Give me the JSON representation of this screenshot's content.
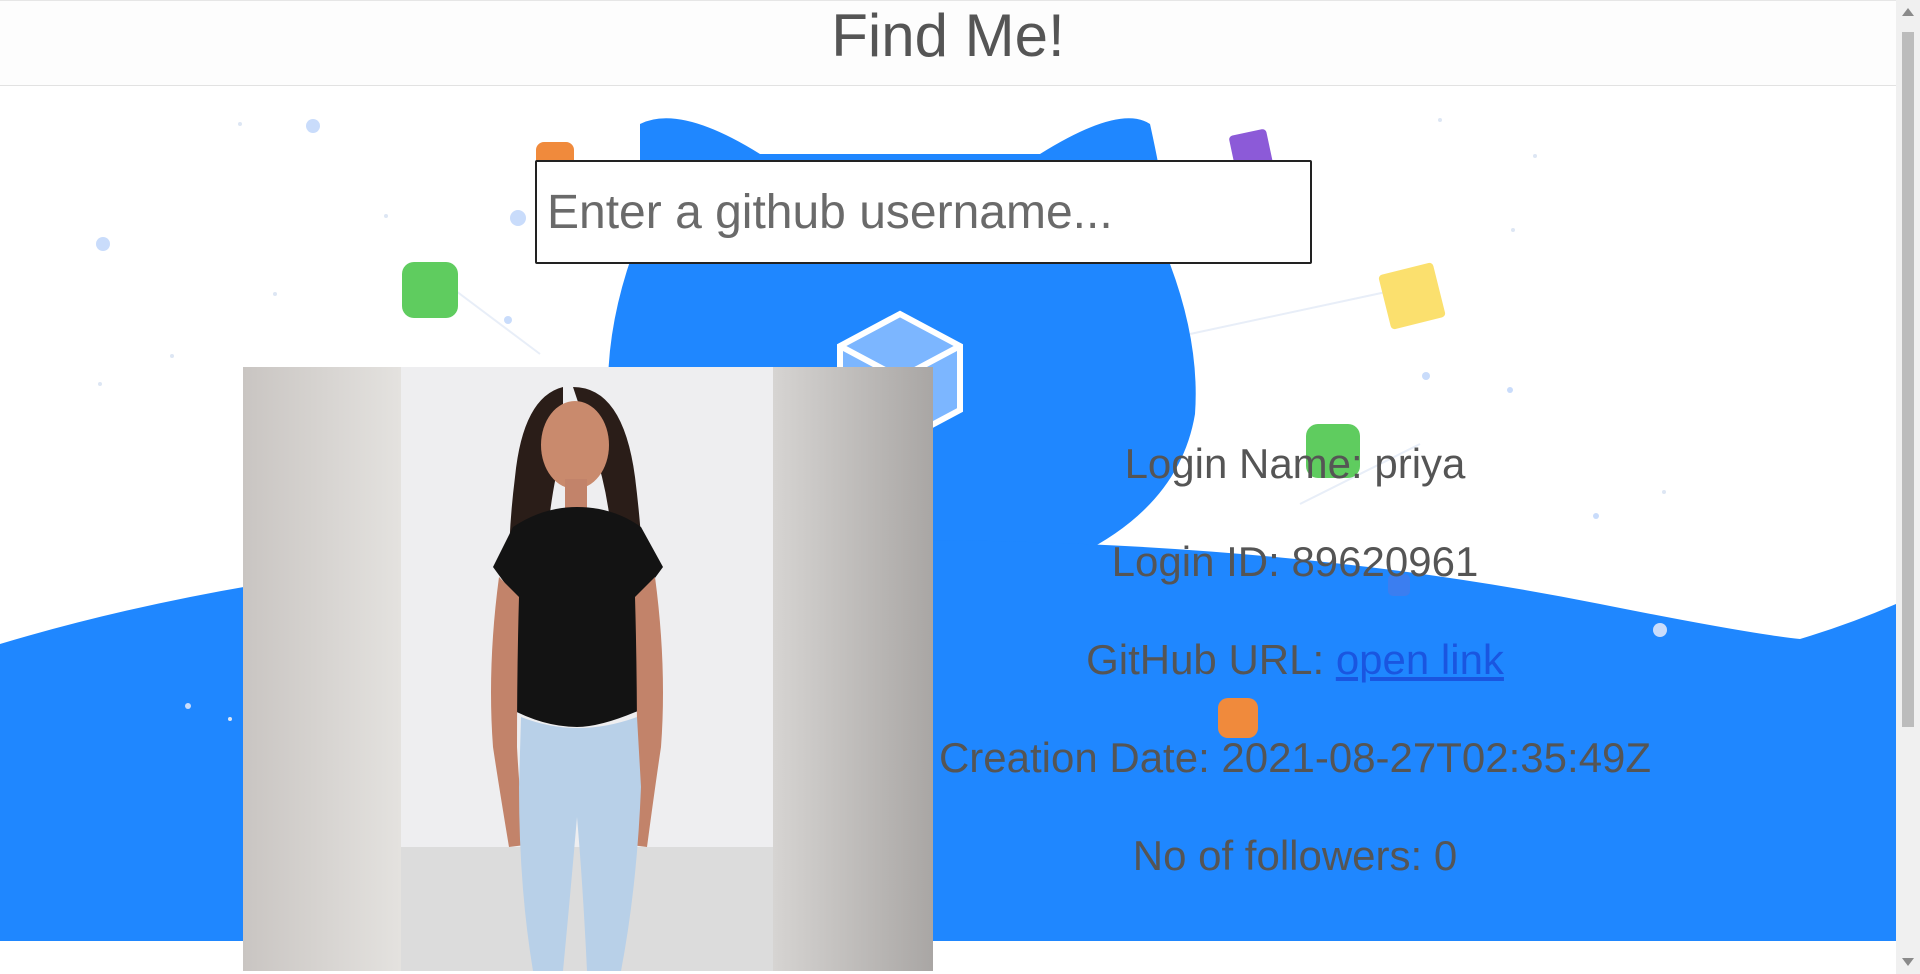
{
  "header": {
    "title": "Find Me!"
  },
  "search": {
    "placeholder": "Enter a github username...",
    "value": ""
  },
  "profile": {
    "login_name_label": "Login Name: ",
    "login_name": "priya",
    "login_id_label": "Login ID: ",
    "login_id": "89620961",
    "github_url_label": "GitHub URL: ",
    "github_url_link_text": "open link",
    "creation_date_label": "Creation Date: ",
    "creation_date": "2021-08-27T02:35:49Z",
    "followers_label": "No of followers: ",
    "followers": "0"
  },
  "colors": {
    "accent_blue": "#1f87ff",
    "link_blue": "#1a56e0",
    "text_gray": "#555555"
  }
}
